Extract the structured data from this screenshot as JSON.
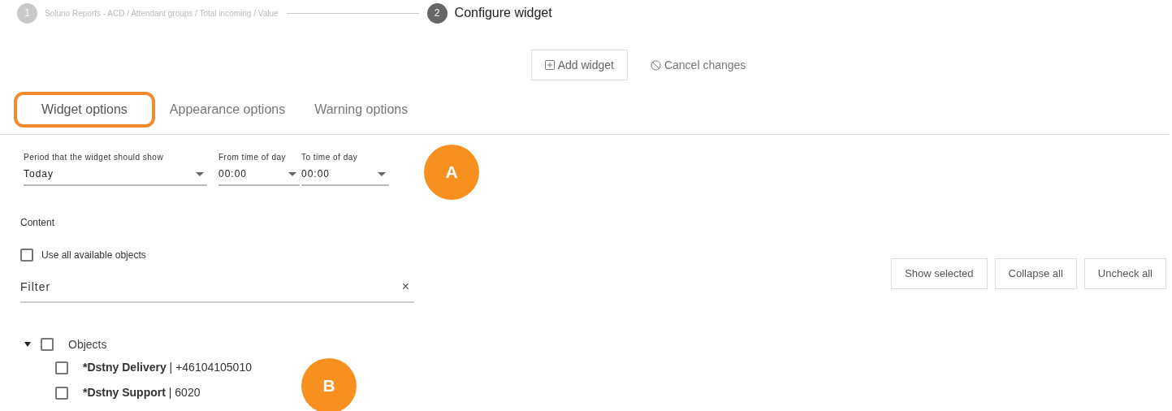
{
  "stepper": [
    {
      "number": "1",
      "label": "Soluno Reports - ACD / Attendant groups / Total incoming / Value",
      "selected": false
    },
    {
      "number": "2",
      "label": "Configure widget",
      "selected": true
    }
  ],
  "actions": [
    {
      "kind": "add",
      "label": "Add widget"
    },
    {
      "kind": "cancel",
      "label": "Cancel changes"
    }
  ],
  "tabs": [
    {
      "label": "Widget options",
      "selected": true,
      "highlighted": true
    },
    {
      "label": "Appearance options",
      "selected": false,
      "highlighted": false
    },
    {
      "label": "Warning options",
      "selected": false,
      "highlighted": false
    }
  ],
  "fields": [
    {
      "label": "Period that the widget should show",
      "value": "Today"
    },
    {
      "label": "From time of day",
      "value": "00:00"
    },
    {
      "label": "To time of day",
      "value": "00:00"
    }
  ],
  "content": {
    "heading": "Content",
    "use_all": {
      "label": "Use all available objects",
      "checked": false
    },
    "filter": {
      "placeholder": "Filter",
      "clear": "×"
    }
  },
  "tree_buttons": [
    "Show selected",
    "Collapse all",
    "Uncheck all"
  ],
  "tree": [
    {
      "label": "Objects",
      "expanded": true,
      "checked": false,
      "children": [
        {
          "name": "*Dstny Delivery",
          "detail": " | +46104105010",
          "checked": false
        },
        {
          "name": "*Dstny Support",
          "detail": " | 6020",
          "checked": false
        }
      ]
    }
  ],
  "callouts": [
    "A",
    "B"
  ]
}
